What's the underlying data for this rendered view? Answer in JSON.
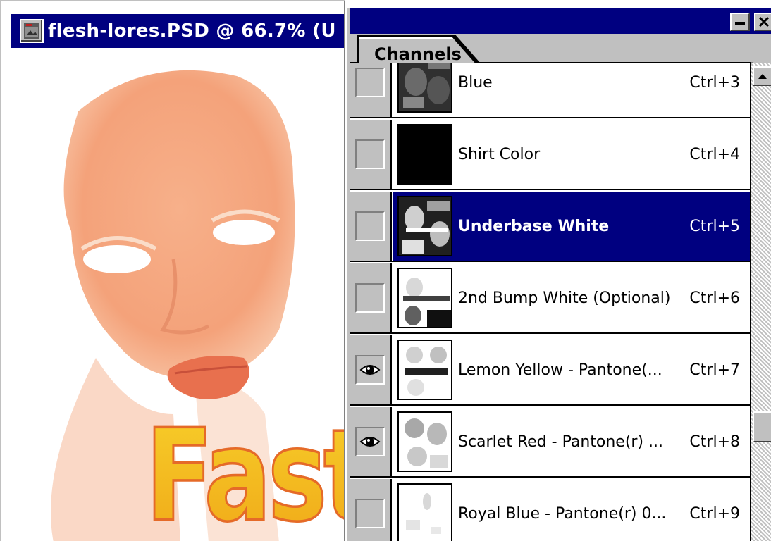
{
  "document": {
    "title": "flesh-lores.PSD @ 66.7% (U",
    "artwork_text": "Fast"
  },
  "palette": {
    "tab_label": "Channels",
    "channels": [
      {
        "name": "Blue",
        "shortcut": "Ctrl+3",
        "visible": false,
        "selected": false
      },
      {
        "name": "Shirt Color",
        "shortcut": "Ctrl+4",
        "visible": false,
        "selected": false
      },
      {
        "name": "Underbase White",
        "shortcut": "Ctrl+5",
        "visible": false,
        "selected": true
      },
      {
        "name": "2nd Bump White (Optional)",
        "shortcut": "Ctrl+6",
        "visible": false,
        "selected": false
      },
      {
        "name": "Lemon Yellow - Pantone(...",
        "shortcut": "Ctrl+7",
        "visible": true,
        "selected": false
      },
      {
        "name": "Scarlet Red - Pantone(r) ...",
        "shortcut": "Ctrl+8",
        "visible": true,
        "selected": false
      },
      {
        "name": "Royal Blue - Pantone(r) 0...",
        "shortcut": "Ctrl+9",
        "visible": false,
        "selected": false
      }
    ]
  },
  "colors": {
    "titlebar": "#000080",
    "selection": "#000080",
    "chrome": "#c0c0c0",
    "skin": "#f4a27a",
    "text_yellow": "#f5c21b"
  }
}
